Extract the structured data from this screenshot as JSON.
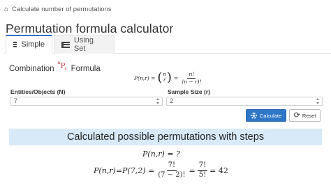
{
  "breadcrumb": {
    "text": "Calculate number of permutations",
    "icon": "home-icon"
  },
  "page_title": "Permutation formula calculator",
  "tabs": [
    {
      "label": "Simple",
      "icon": "lines-icon",
      "active": true
    },
    {
      "label": "Using Set",
      "icon": "list-icon",
      "active": false
    }
  ],
  "section": {
    "prefix": "Combination",
    "symbol_sup": "n",
    "symbol_base": "P",
    "symbol_sub": "r",
    "suffix": "Formula"
  },
  "formula": {
    "lhs": "P(n,r) =",
    "binom_top": "n",
    "binom_bottom": "r",
    "eq": "=",
    "numerator": "n!",
    "denominator": "(n − r)!"
  },
  "fields": {
    "entities": {
      "label": "Entities/Objects (N)",
      "value": "7"
    },
    "sample": {
      "label": "Sample Size (r)",
      "value": "2"
    }
  },
  "buttons": {
    "calculate": "Calculate",
    "reset": "Reset"
  },
  "result": {
    "banner": "Calculated possible permutations with steps",
    "line1": "P(n,r) = ?",
    "step_lhs": "P(n,r)=P(7,2) =",
    "f1_num": "7!",
    "f1_den": "(7 − 2)!",
    "eq_a": "=",
    "f2_num": "7!",
    "f2_den": "5!",
    "eq_b": "= 42"
  },
  "colors": {
    "accent": "#2e76c7",
    "banner": "#d8eaf8",
    "symbol": "#cc3333"
  }
}
